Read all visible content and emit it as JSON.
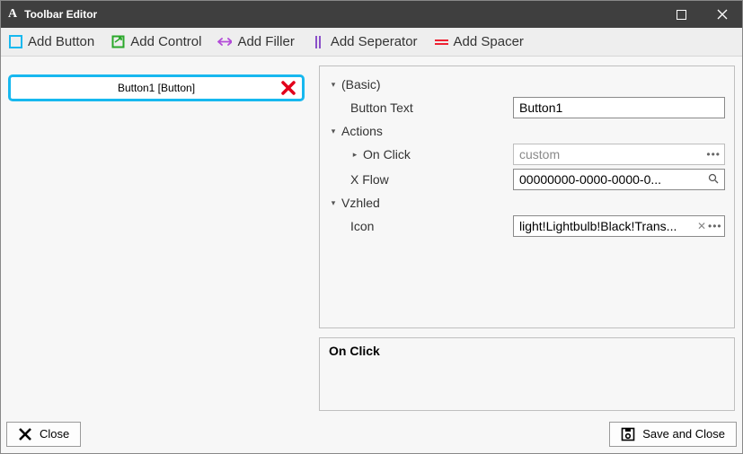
{
  "window": {
    "title": "Toolbar Editor"
  },
  "toolbar": {
    "add_button": "Add Button",
    "add_control": "Add Control",
    "add_filler": "Add Filler",
    "add_separator": "Add Seperator",
    "add_spacer": "Add Spacer"
  },
  "items": [
    {
      "label": "Button1 [Button]"
    }
  ],
  "props": {
    "group_basic": "(Basic)",
    "button_text_label": "Button Text",
    "button_text_value": "Button1",
    "group_actions": "Actions",
    "on_click_label": "On Click",
    "on_click_value": "custom",
    "xflow_label": "X Flow",
    "xflow_value": "00000000-0000-0000-0...",
    "group_appearance": "Vzhled",
    "icon_label": "Icon",
    "icon_value": "light!Lightbulb!Black!Trans..."
  },
  "event_panel": {
    "header": "On Click"
  },
  "footer": {
    "close": "Close",
    "save_close": "Save and Close"
  }
}
